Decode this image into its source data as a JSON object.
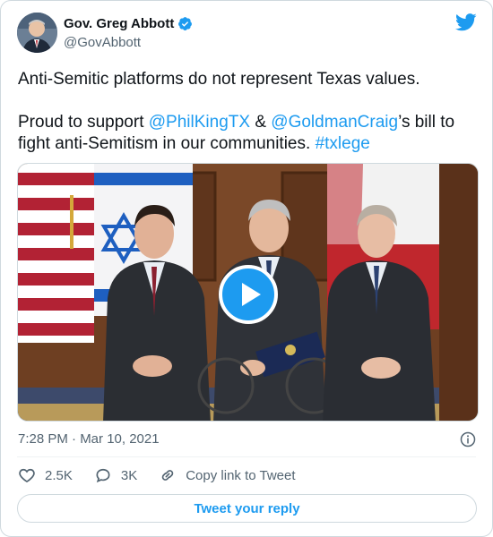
{
  "author": {
    "name": "Gov. Greg Abbott",
    "handle": "@GovAbbott"
  },
  "tweet": {
    "line1": "Anti-Semitic platforms do not represent Texas values.",
    "line2_pre": "Proud to support ",
    "mention1": "@PhilKingTX",
    "amp": " & ",
    "mention2": "@GoldmanCraig",
    "line2_post": "’s bill to fight anti-Semitism in our communities. ",
    "hashtag": "#txlege"
  },
  "meta": {
    "timestamp": "7:28 PM · Mar 10, 2021"
  },
  "actions": {
    "likes": "2.5K",
    "replies": "3K",
    "share_label": "Copy link to Tweet"
  },
  "reply_button": "Tweet your reply",
  "colors": {
    "accent": "#1d9bf0",
    "text": "#0f1419",
    "secondary": "#536471"
  },
  "icons": [
    "verified-badge-icon",
    "twitter-bird-icon",
    "play-icon",
    "info-icon",
    "heart-icon",
    "reply-icon",
    "link-icon"
  ]
}
